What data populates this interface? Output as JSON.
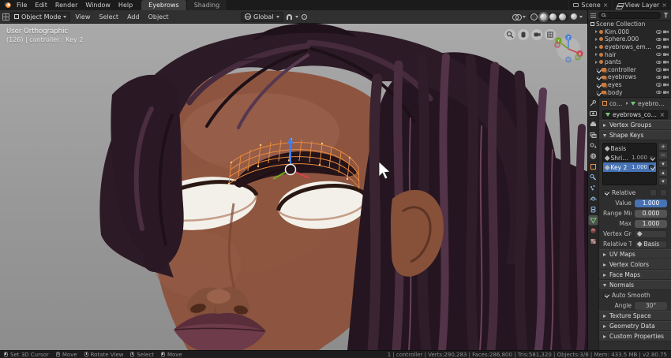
{
  "icons": {
    "close": "×",
    "plus": "+",
    "minus": "−",
    "menu": "▾",
    "up": "▴",
    "down": "▾"
  },
  "topbar": {
    "menus": [
      "File",
      "Edit",
      "Render",
      "Window",
      "Help"
    ],
    "tabs": [
      {
        "label": "Eyebrows",
        "active": true
      },
      {
        "label": "Shading",
        "active": false
      }
    ],
    "scene_label": "Scene",
    "view_layer_label": "View Layer"
  },
  "toolbar": {
    "mode": "Object Mode",
    "menus": [
      "View",
      "Select",
      "Add",
      "Object"
    ],
    "orientation": "Global"
  },
  "viewport": {
    "view_label": "User Orthographic",
    "context_label": "(126) | controller : Key 2",
    "axis": {
      "x": "X",
      "y": "Y",
      "z": "Z"
    }
  },
  "outliner": {
    "root_label": "Scene Collection",
    "rows": [
      {
        "name": "Kim.000"
      },
      {
        "name": "Sphere.000"
      },
      {
        "name": "eyebrows_empty"
      },
      {
        "name": "hair"
      },
      {
        "name": "pants"
      },
      {
        "name": "controller"
      },
      {
        "name": "eyebrows"
      },
      {
        "name": "eyes"
      },
      {
        "name": "body"
      }
    ]
  },
  "properties": {
    "breadcrumb_object": "controller",
    "breadcrumb_data": "eyebrows_controller",
    "datablock_name": "eyebrows_controller",
    "panels": {
      "vertex_groups": "Vertex Groups",
      "shape_keys": "Shape Keys",
      "uv_maps": "UV Maps",
      "vertex_colors": "Vertex Colors",
      "face_maps": "Face Maps",
      "normals": "Normals",
      "texture_space": "Texture Space",
      "geometry_data": "Geometry Data",
      "custom_properties": "Custom Properties"
    },
    "shape_keys": {
      "items": [
        {
          "name": "Basis",
          "value": ""
        },
        {
          "name": "Shrinkwrap",
          "value": "1.000"
        },
        {
          "name": "Key 2",
          "value": "1.000"
        }
      ],
      "relative_label": "Relative",
      "value_label": "Value",
      "value": "1.000",
      "range_min_label": "Range Min",
      "range_min": "0.000",
      "max_label": "Max",
      "max": "1.000",
      "vertex_group_label": "Vertex Group",
      "relative_to_label": "Relative To",
      "relative_to": "Basis"
    },
    "normals": {
      "auto_smooth_label": "Auto Smooth",
      "angle_label": "Angle",
      "angle_value": "30°"
    }
  },
  "statusbar": {
    "hints": [
      {
        "label": "Set 3D Cursor"
      },
      {
        "label": "Move"
      },
      {
        "label": "Rotate View"
      },
      {
        "label": "Select"
      },
      {
        "label": "Move"
      }
    ],
    "stats": "1 | controller | Verts:290,283 | Faces:286,800 | Tris:581,320 | Objects:3/8 | Mem: 433.5 MB | v2.80.75"
  },
  "colors": {
    "accent_blue": "#4772b3",
    "selection_orange": "#e8853d"
  }
}
